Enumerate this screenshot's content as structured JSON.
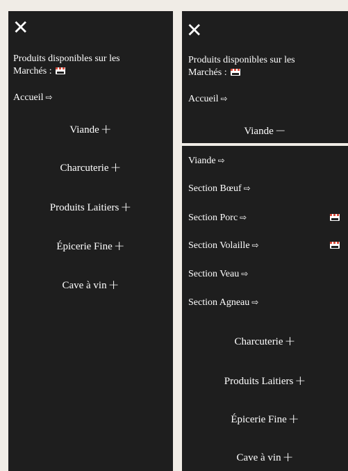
{
  "close_glyph": "✕",
  "intro_line1": "Produits disponibles sur les",
  "intro_line2": "Marchés :",
  "home_label": "Accueil",
  "arrow_glyph": "⇨",
  "plus_glyph": "+",
  "minus_glyph": "−",
  "stall_icon_name": "market-stall-icon",
  "categories": {
    "viande": "Viande",
    "charcuterie": "Charcuterie",
    "laitiers": "Produits Laitiers",
    "epicerie": "Épicerie Fine",
    "cave": "Cave à vin"
  },
  "submenu_viande": [
    {
      "label": "Viande",
      "stall": false
    },
    {
      "label": "Section Bœuf",
      "stall": false
    },
    {
      "label": "Section Porc",
      "stall": true
    },
    {
      "label": "Section Volaille",
      "stall": true
    },
    {
      "label": "Section Veau",
      "stall": false
    },
    {
      "label": "Section Agneau",
      "stall": false
    }
  ],
  "colors": {
    "panel_bg": "#1e1e1e",
    "page_bg": "#f0ece6",
    "text": "#ffffff"
  }
}
